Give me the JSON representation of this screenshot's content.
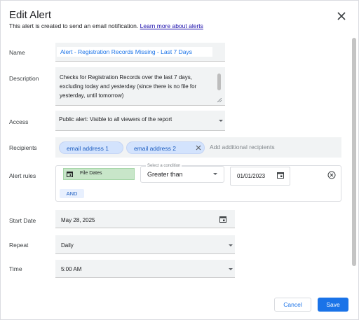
{
  "dialog": {
    "title": "Edit Alert",
    "subtitle": "This alert is created to send an email notification.",
    "learn_more": "Learn more about alerts"
  },
  "labels": {
    "name": "Name",
    "description": "Description",
    "access": "Access",
    "recipients": "Recipients",
    "alert_rules": "Alert rules",
    "start_date": "Start Date",
    "repeat": "Repeat",
    "time": "Time"
  },
  "name": {
    "value": "Alert - Registration Records Missing - Last 7 Days"
  },
  "description": {
    "value": "Checks for  Registration Records  over the last 7 days, excluding today and yesterday (since there is no file for yesterday, until tomorrow)"
  },
  "access": {
    "value": "Public alert: Visible to all viewers of the report"
  },
  "recipients": {
    "chips": [
      "email address 1",
      "email address 2"
    ],
    "placeholder": "Add additional recipients"
  },
  "alert_rules": {
    "field": "File Dates",
    "condition_label": "Select a condition",
    "condition_value": "Greater than",
    "date_value": "01/01/2023",
    "and_label": "AND"
  },
  "start_date": {
    "value": "May 28, 2025"
  },
  "repeat": {
    "value": "Daily"
  },
  "time": {
    "value": "5:00 AM"
  },
  "buttons": {
    "cancel": "Cancel",
    "save": "Save"
  },
  "colors": {
    "accent": "#1a73e8",
    "chip": "#d3e3fd",
    "field_chip": "#c8e6c9"
  }
}
